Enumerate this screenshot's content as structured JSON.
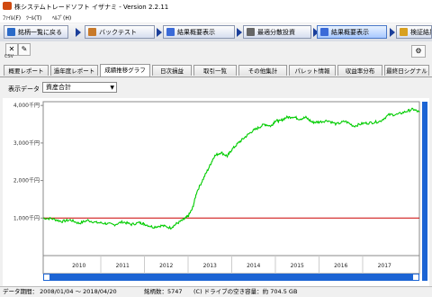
{
  "titlebar": {
    "title": "株システムトレードソフト イザナミ - Version 2.2.11"
  },
  "menubar": {
    "items": [
      "ﾌｧｲﾙ(F)",
      "ﾂｰﾙ(T)",
      "ﾍﾙﾌﾟ(H)"
    ]
  },
  "nav": {
    "buttons": [
      {
        "label": "銘柄一覧に戻る",
        "icon_color": "#2a6ac8"
      },
      {
        "label": "バックテスト",
        "icon_color": "#c87a2a"
      },
      {
        "label": "結果概要表示",
        "icon_color": "#3a6ad8"
      },
      {
        "label": "最適分散投資",
        "icon_color": "#666666"
      },
      {
        "label": "結果概要表示",
        "icon_color": "#3a6ad8"
      },
      {
        "label": "検証結果を",
        "icon_color": "#d8a020"
      }
    ]
  },
  "toolbar": {
    "csv_label": "CSV"
  },
  "tabs": [
    "概要レポート",
    "過年度レポート",
    "成績推移グラフ",
    "日次損益",
    "取引一覧",
    "その他集計",
    "パレット情報",
    "収益率分布",
    "最終日シグナル"
  ],
  "selected_tab": 2,
  "data_selector": {
    "label": "表示データ",
    "value": "資産合計"
  },
  "chart_data": {
    "type": "line",
    "ylim": [
      0,
      4100
    ],
    "yticks": [
      1000,
      2000,
      3000,
      4000
    ],
    "ytick_labels": [
      "1,000千円",
      "2,000千円",
      "3,000千円",
      "4,000千円"
    ],
    "xtick_labels": [
      "2010",
      "2011",
      "2012",
      "2013",
      "2014",
      "2015",
      "2016",
      "2017"
    ],
    "xrange": [
      2009.68,
      2018.3
    ],
    "baseline": 1000,
    "line_color": "#00cc00",
    "baseline_color": "#cc0000",
    "series": [
      {
        "x": [
          2009.68,
          2009.9,
          2010.1,
          2010.3,
          2010.5,
          2010.7,
          2010.9,
          2011.1,
          2011.3,
          2011.5,
          2011.7,
          2011.9,
          2012.0,
          2012.2,
          2012.4,
          2012.6,
          2012.75,
          2012.9,
          2013.0,
          2013.1,
          2013.2,
          2013.35,
          2013.5,
          2013.6,
          2013.75,
          2013.9,
          2014.0,
          2014.15,
          2014.3,
          2014.45,
          2014.6,
          2014.75,
          2014.9,
          2015.0,
          2015.1,
          2015.25,
          2015.4,
          2015.55,
          2015.7,
          2015.85,
          2016.0,
          2016.2,
          2016.4,
          2016.6,
          2016.8,
          2017.0,
          2017.2,
          2017.4,
          2017.6,
          2017.8,
          2018.0,
          2018.15,
          2018.3
        ],
        "y": [
          1000,
          980,
          910,
          950,
          860,
          940,
          880,
          860,
          820,
          900,
          830,
          880,
          840,
          760,
          800,
          740,
          860,
          960,
          1050,
          1250,
          1700,
          2050,
          2400,
          2650,
          2750,
          2650,
          2820,
          3000,
          3150,
          3300,
          3400,
          3500,
          3450,
          3600,
          3580,
          3680,
          3700,
          3640,
          3680,
          3550,
          3560,
          3600,
          3500,
          3580,
          3450,
          3520,
          3540,
          3580,
          3750,
          3760,
          3840,
          3900,
          3820
        ]
      }
    ]
  },
  "statusbar": {
    "period": "データ期間： 2008/01/04 ～ 2018/04/20",
    "count": "銘柄数：5747",
    "disk": "(C) ドライブの空き容量：約 704.5 GB"
  }
}
